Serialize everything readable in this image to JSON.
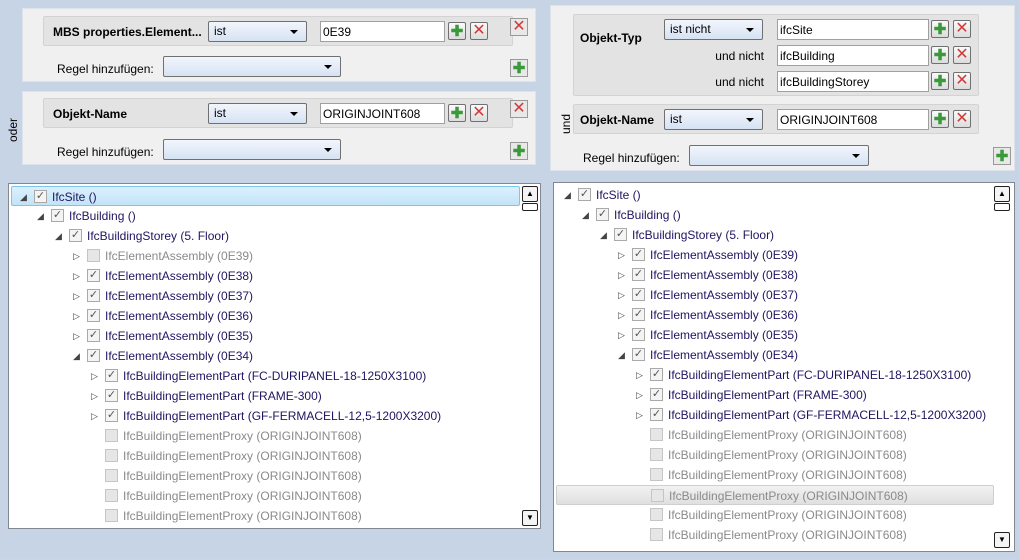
{
  "left": {
    "connector": "oder",
    "groups": [
      {
        "field": "MBS properties.Element...",
        "op": "ist",
        "value": "0E39",
        "add_rule_label": "Regel hinzufügen:",
        "add_rule_value": ""
      },
      {
        "field": "Objekt-Name",
        "op": "ist",
        "value": "ORIGINJOINT608",
        "add_rule_label": "Regel hinzufügen:",
        "add_rule_value": ""
      }
    ],
    "tree": [
      {
        "label": "IfcSite ()",
        "level": 0,
        "exp": "open",
        "checked": true,
        "dim": false,
        "state": "selected"
      },
      {
        "label": "IfcBuilding ()",
        "level": 1,
        "exp": "open",
        "checked": true,
        "dim": false
      },
      {
        "label": "IfcBuildingStorey (5. Floor)",
        "level": 2,
        "exp": "open",
        "checked": true,
        "dim": false
      },
      {
        "label": "IfcElementAssembly (0E39)",
        "level": 3,
        "exp": "closed",
        "checked": false,
        "dim": true
      },
      {
        "label": "IfcElementAssembly (0E38)",
        "level": 3,
        "exp": "closed",
        "checked": true,
        "dim": false
      },
      {
        "label": "IfcElementAssembly (0E37)",
        "level": 3,
        "exp": "closed",
        "checked": true,
        "dim": false
      },
      {
        "label": "IfcElementAssembly (0E36)",
        "level": 3,
        "exp": "closed",
        "checked": true,
        "dim": false
      },
      {
        "label": "IfcElementAssembly (0E35)",
        "level": 3,
        "exp": "closed",
        "checked": true,
        "dim": false
      },
      {
        "label": "IfcElementAssembly (0E34)",
        "level": 3,
        "exp": "open",
        "checked": true,
        "dim": false
      },
      {
        "label": "IfcBuildingElementPart (FC-DURIPANEL-18-1250X3100)",
        "level": 4,
        "exp": "closed",
        "checked": true,
        "dim": false
      },
      {
        "label": "IfcBuildingElementPart (FRAME-300)",
        "level": 4,
        "exp": "closed",
        "checked": true,
        "dim": false
      },
      {
        "label": "IfcBuildingElementPart (GF-FERMACELL-12,5-1200X3200)",
        "level": 4,
        "exp": "closed",
        "checked": true,
        "dim": false
      },
      {
        "label": "IfcBuildingElementProxy (ORIGINJOINT608)",
        "level": 4,
        "exp": "none",
        "checked": false,
        "dim": true
      },
      {
        "label": "IfcBuildingElementProxy (ORIGINJOINT608)",
        "level": 4,
        "exp": "none",
        "checked": false,
        "dim": true
      },
      {
        "label": "IfcBuildingElementProxy (ORIGINJOINT608)",
        "level": 4,
        "exp": "none",
        "checked": false,
        "dim": true
      },
      {
        "label": "IfcBuildingElementProxy (ORIGINJOINT608)",
        "level": 4,
        "exp": "none",
        "checked": false,
        "dim": true
      },
      {
        "label": "IfcBuildingElementProxy (ORIGINJOINT608)",
        "level": 4,
        "exp": "none",
        "checked": false,
        "dim": true
      }
    ]
  },
  "right": {
    "connector": "und",
    "type_rule": {
      "field": "Objekt-Typ",
      "op": "ist nicht",
      "values": [
        "ifcSite",
        "ifcBuilding",
        "ifcBuildingStorey"
      ],
      "and_not_label": "und nicht"
    },
    "name_rule": {
      "field": "Objekt-Name",
      "op": "ist",
      "value": "ORIGINJOINT608"
    },
    "add_rule_label": "Regel hinzufügen:",
    "add_rule_value": "",
    "tree": [
      {
        "label": "IfcSite ()",
        "level": 0,
        "exp": "open",
        "checked": true,
        "dim": false
      },
      {
        "label": "IfcBuilding ()",
        "level": 1,
        "exp": "open",
        "checked": true,
        "dim": false
      },
      {
        "label": "IfcBuildingStorey (5. Floor)",
        "level": 2,
        "exp": "open",
        "checked": true,
        "dim": false
      },
      {
        "label": "IfcElementAssembly (0E39)",
        "level": 3,
        "exp": "closed",
        "checked": true,
        "dim": false
      },
      {
        "label": "IfcElementAssembly (0E38)",
        "level": 3,
        "exp": "closed",
        "checked": true,
        "dim": false
      },
      {
        "label": "IfcElementAssembly (0E37)",
        "level": 3,
        "exp": "closed",
        "checked": true,
        "dim": false
      },
      {
        "label": "IfcElementAssembly (0E36)",
        "level": 3,
        "exp": "closed",
        "checked": true,
        "dim": false
      },
      {
        "label": "IfcElementAssembly (0E35)",
        "level": 3,
        "exp": "closed",
        "checked": true,
        "dim": false
      },
      {
        "label": "IfcElementAssembly (0E34)",
        "level": 3,
        "exp": "open",
        "checked": true,
        "dim": false
      },
      {
        "label": "IfcBuildingElementPart (FC-DURIPANEL-18-1250X3100)",
        "level": 4,
        "exp": "closed",
        "checked": true,
        "dim": false
      },
      {
        "label": "IfcBuildingElementPart (FRAME-300)",
        "level": 4,
        "exp": "closed",
        "checked": true,
        "dim": false
      },
      {
        "label": "IfcBuildingElementPart (GF-FERMACELL-12,5-1200X3200)",
        "level": 4,
        "exp": "closed",
        "checked": true,
        "dim": false
      },
      {
        "label": "IfcBuildingElementProxy (ORIGINJOINT608)",
        "level": 4,
        "exp": "none",
        "checked": false,
        "dim": true
      },
      {
        "label": "IfcBuildingElementProxy (ORIGINJOINT608)",
        "level": 4,
        "exp": "none",
        "checked": false,
        "dim": true
      },
      {
        "label": "IfcBuildingElementProxy (ORIGINJOINT608)",
        "level": 4,
        "exp": "none",
        "checked": false,
        "dim": true
      },
      {
        "label": "IfcBuildingElementProxy (ORIGINJOINT608)",
        "level": 4,
        "exp": "none",
        "checked": false,
        "dim": true,
        "state": "hover"
      },
      {
        "label": "IfcBuildingElementProxy (ORIGINJOINT608)",
        "level": 4,
        "exp": "none",
        "checked": false,
        "dim": true
      },
      {
        "label": "IfcBuildingElementProxy (ORIGINJOINT608)",
        "level": 4,
        "exp": "none",
        "checked": false,
        "dim": true
      }
    ]
  }
}
